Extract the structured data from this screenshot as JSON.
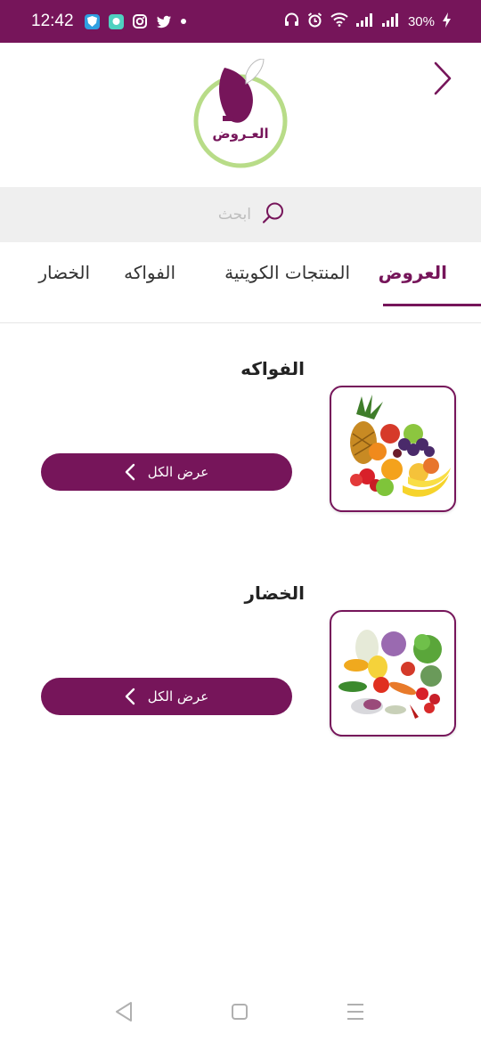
{
  "status_bar": {
    "time": "12:42",
    "battery": "30%",
    "icons": [
      "shield-icon",
      "chat-icon",
      "instagram-icon",
      "twitter-icon",
      "dot-icon",
      "headphones-icon",
      "alarm-icon",
      "wifi-icon",
      "signal-icon",
      "signal-icon",
      "charging-icon"
    ]
  },
  "header": {
    "logo_text": "العـروض",
    "back_icon": "chevron-right-icon"
  },
  "search": {
    "placeholder": "ابحث",
    "icon": "search-icon"
  },
  "tabs": [
    {
      "label": "العروض",
      "active": true
    },
    {
      "label": "المنتجات الكويتية",
      "active": false
    },
    {
      "label": "الفواكه",
      "active": false
    },
    {
      "label": "الخضار",
      "active": false
    }
  ],
  "sections": [
    {
      "title": "الفواكه",
      "button_label": "عرض الكل"
    },
    {
      "title": "الخضار",
      "button_label": "عرض الكل"
    }
  ],
  "colors": {
    "primary": "#76155a",
    "logo_ring": "#b8dc88",
    "search_bg": "#efefef"
  }
}
